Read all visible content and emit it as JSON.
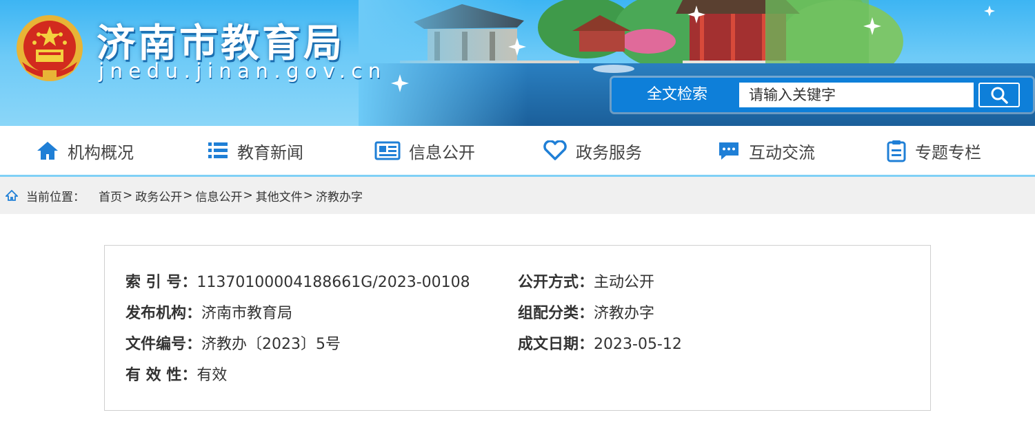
{
  "header": {
    "title": "济南市教育局",
    "subtitle": "jnedu.jinan.gov.cn",
    "search_label": "全文检索",
    "search_placeholder": "请输入关键字"
  },
  "nav": {
    "items": [
      {
        "label": "机构概况",
        "icon": "home-icon"
      },
      {
        "label": "教育新闻",
        "icon": "list-icon"
      },
      {
        "label": "信息公开",
        "icon": "newspaper-icon"
      },
      {
        "label": "政务服务",
        "icon": "heart-icon"
      },
      {
        "label": "互动交流",
        "icon": "chat-icon"
      },
      {
        "label": "专题专栏",
        "icon": "clipboard-icon"
      }
    ]
  },
  "breadcrumb": {
    "label": "当前位置：",
    "items": [
      "首页",
      "政务公开",
      "信息公开",
      "其他文件",
      "济教办字"
    ]
  },
  "info": {
    "index_key": "索 引 号：",
    "index_val": "11370100004188661G/2023-00108",
    "publisher_key": "发布机构：",
    "publisher_val": "济南市教育局",
    "docno_key": "文件编号：",
    "docno_val": "济教办〔2023〕5号",
    "validity_key": "有 效 性：",
    "validity_val": "有效",
    "mode_key": "公开方式：",
    "mode_val": "主动公开",
    "category_key": "组配分类：",
    "category_val": "济教办字",
    "date_key": "成文日期：",
    "date_val": "2023-05-12"
  },
  "colors": {
    "header_blue": "#3db5f3",
    "search_blue": "#0e7fd9",
    "nav_icon_blue": "#1f7fd6",
    "breadcrumb_bg": "#f0f0f0"
  }
}
